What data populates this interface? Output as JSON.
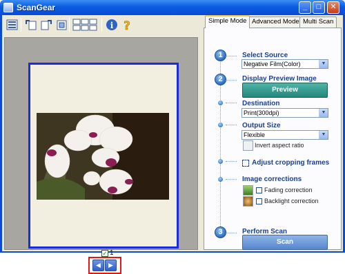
{
  "window": {
    "title": "ScanGear"
  },
  "titlebar_buttons": {
    "minimize": "_",
    "maximize": "□",
    "close": "✕"
  },
  "toolbar": {
    "icons": [
      "scan-all-icon",
      "rotate-left-icon",
      "rotate-right-icon",
      "crop-icon",
      "thumbnail-view-icon",
      "info-icon",
      "help-icon"
    ],
    "info_glyph": "i",
    "help_glyph": "?"
  },
  "preview": {
    "frame_number": "1",
    "checkbox_glyph": "✓",
    "prev_glyph": "◀",
    "next_glyph": "▶"
  },
  "tabs": [
    {
      "label": "Simple Mode",
      "active": true
    },
    {
      "label": "Advanced Mode",
      "active": false
    },
    {
      "label": "Multi Scan",
      "active": false
    }
  ],
  "steps": {
    "one": "1",
    "two": "2",
    "three": "3"
  },
  "simple_mode": {
    "select_source_label": "Select Source",
    "select_source_value": "Negative Film(Color)",
    "display_preview_label": "Display Preview Image",
    "preview_button": "Preview",
    "destination_label": "Destination",
    "destination_value": "Print(300dpi)",
    "output_size_label": "Output Size",
    "output_size_value": "Flexible",
    "invert_aspect_label": "Invert aspect ratio",
    "adjust_cropping_label": "Adjust cropping frames",
    "image_corrections_label": "Image corrections",
    "fading_correction_label": "Fading correction",
    "backlight_correction_label": "Backlight correction",
    "perform_scan_label": "Perform Scan",
    "scan_button": "Scan"
  },
  "colors": {
    "window_blue": "#0a4bd6",
    "preview_button": "#24877b",
    "scan_button": "#5585cc",
    "frame_border": "#1a2ce0",
    "highlight_red": "#e41616"
  }
}
